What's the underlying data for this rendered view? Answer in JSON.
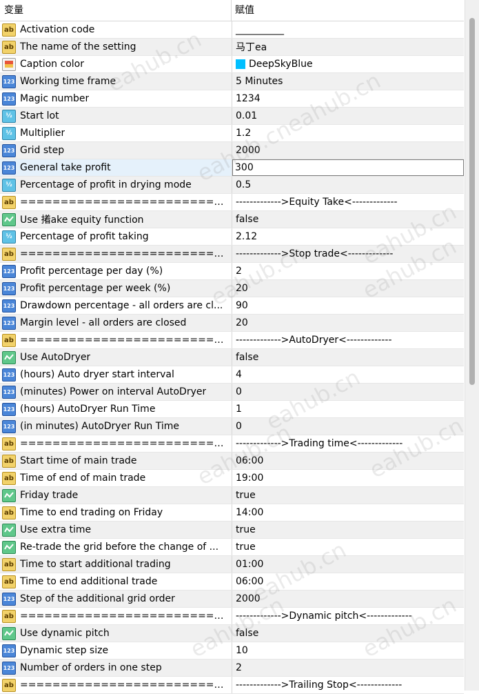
{
  "header": {
    "col_name": "变量",
    "col_value": "赋值"
  },
  "rows": [
    {
      "icon": "ab",
      "name": "Activation code",
      "value": "__________"
    },
    {
      "icon": "ab",
      "name": "The name of the setting",
      "value": "马丁ea"
    },
    {
      "icon": "color",
      "name": "Caption color",
      "value": "DeepSkyBlue",
      "swatch": "#00BFFF"
    },
    {
      "icon": "123",
      "name": "Working time frame",
      "value": "5 Minutes"
    },
    {
      "icon": "123",
      "name": "Magic number",
      "value": "1234"
    },
    {
      "icon": "frac",
      "name": "Start lot",
      "value": "0.01"
    },
    {
      "icon": "frac",
      "name": "Multiplier",
      "value": "1.2"
    },
    {
      "icon": "123",
      "name": "Grid step",
      "value": "2000"
    },
    {
      "icon": "123",
      "name": "General take profit",
      "value": "300",
      "selected": true
    },
    {
      "icon": "frac",
      "name": "Percentage of profit in drying mode",
      "value": "0.5"
    },
    {
      "icon": "ab",
      "name": "==========================...",
      "value": "------------->Equity Take<-------------"
    },
    {
      "icon": "bool",
      "name": "Use 撯ake equity function",
      "value": "false"
    },
    {
      "icon": "frac",
      "name": "Percentage of profit taking",
      "value": "2.12"
    },
    {
      "icon": "ab",
      "name": "==========================...",
      "value": "------------->Stop trade<-------------"
    },
    {
      "icon": "123",
      "name": "Profit percentage per day (%)",
      "value": "2"
    },
    {
      "icon": "123",
      "name": "Profit percentage per week (%)",
      "value": "20"
    },
    {
      "icon": "123",
      "name": "Drawdown percentage - all orders are cl...",
      "value": "90"
    },
    {
      "icon": "123",
      "name": "Margin level - all orders are closed",
      "value": "20"
    },
    {
      "icon": "ab",
      "name": "==========================...",
      "value": "------------->AutoDryer<-------------"
    },
    {
      "icon": "bool",
      "name": "Use AutoDryer",
      "value": "false"
    },
    {
      "icon": "123",
      "name": "(hours) Auto dryer start interval",
      "value": "4"
    },
    {
      "icon": "123",
      "name": "(minutes) Power on interval AutoDryer",
      "value": "0"
    },
    {
      "icon": "123",
      "name": "(hours) AutoDryer Run Time",
      "value": "1"
    },
    {
      "icon": "123",
      "name": "(in minutes) AutoDryer Run Time",
      "value": "0"
    },
    {
      "icon": "ab",
      "name": "==========================...",
      "value": "------------->Trading time<-------------"
    },
    {
      "icon": "ab",
      "name": "Start time of main trade",
      "value": "06:00"
    },
    {
      "icon": "ab",
      "name": "Time of end of main trade",
      "value": "19:00"
    },
    {
      "icon": "bool",
      "name": "Friday trade",
      "value": "true"
    },
    {
      "icon": "ab",
      "name": "Time to end trading on Friday",
      "value": "14:00"
    },
    {
      "icon": "bool",
      "name": "Use extra time",
      "value": "true"
    },
    {
      "icon": "bool",
      "name": "Re-trade the grid before the change of ...",
      "value": "true"
    },
    {
      "icon": "ab",
      "name": "Time to start additional trading",
      "value": "01:00"
    },
    {
      "icon": "ab",
      "name": "Time to end additional trade",
      "value": "06:00"
    },
    {
      "icon": "123",
      "name": "Step of the additional grid order",
      "value": "2000"
    },
    {
      "icon": "ab",
      "name": "==========================...",
      "value": "------------->Dynamic pitch<-------------"
    },
    {
      "icon": "bool",
      "name": "Use dynamic pitch",
      "value": "false"
    },
    {
      "icon": "123",
      "name": "Dynamic step size",
      "value": "10"
    },
    {
      "icon": "123",
      "name": "Number of orders in one step",
      "value": "2"
    },
    {
      "icon": "ab",
      "name": "==========================...",
      "value": "------------->Trailing Stop<-------------"
    }
  ],
  "watermark": "eahub.cn"
}
